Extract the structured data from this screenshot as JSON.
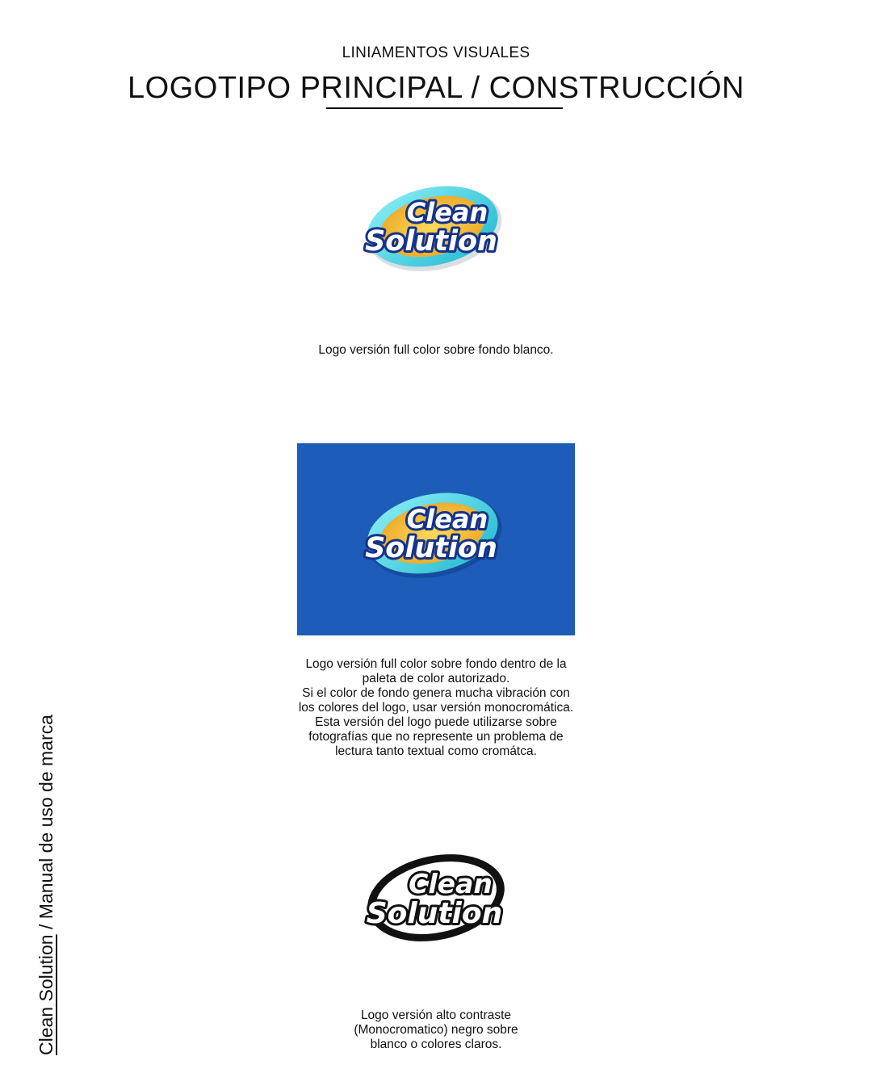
{
  "header": {
    "kicker": "LINIAMENTOS VISUALES",
    "title": "LOGOTIPO PRINCIPAL / CONSTRUCCIÓN"
  },
  "logo": {
    "line1": "Clean",
    "line2": "Solution"
  },
  "sections": [
    {
      "caption": "Logo versión full color sobre fondo blanco."
    },
    {
      "caption": "Logo versión full color sobre fondo dentro de la\npaleta de color autorizado.\nSi el color de fondo genera mucha vibración con\nlos colores del logo, usar versión monocromática.\nEsta versión del logo puede utilizarse sobre\nfotografías que no represente un problema de\nlectura tanto textual como cromátca."
    },
    {
      "caption": "Logo versión alto contraste\n(Monocromatico) negro sobre\nblanco o colores claros."
    }
  ],
  "side_label": {
    "brand": "Clean Solution",
    "rest": " / Manual de uso de marca"
  },
  "colors": {
    "panel_blue": "#1d5cb8",
    "logo_cyan": "#39d0e0",
    "logo_yellow": "#f2b733",
    "logo_navy": "#15338a",
    "black": "#111111"
  }
}
